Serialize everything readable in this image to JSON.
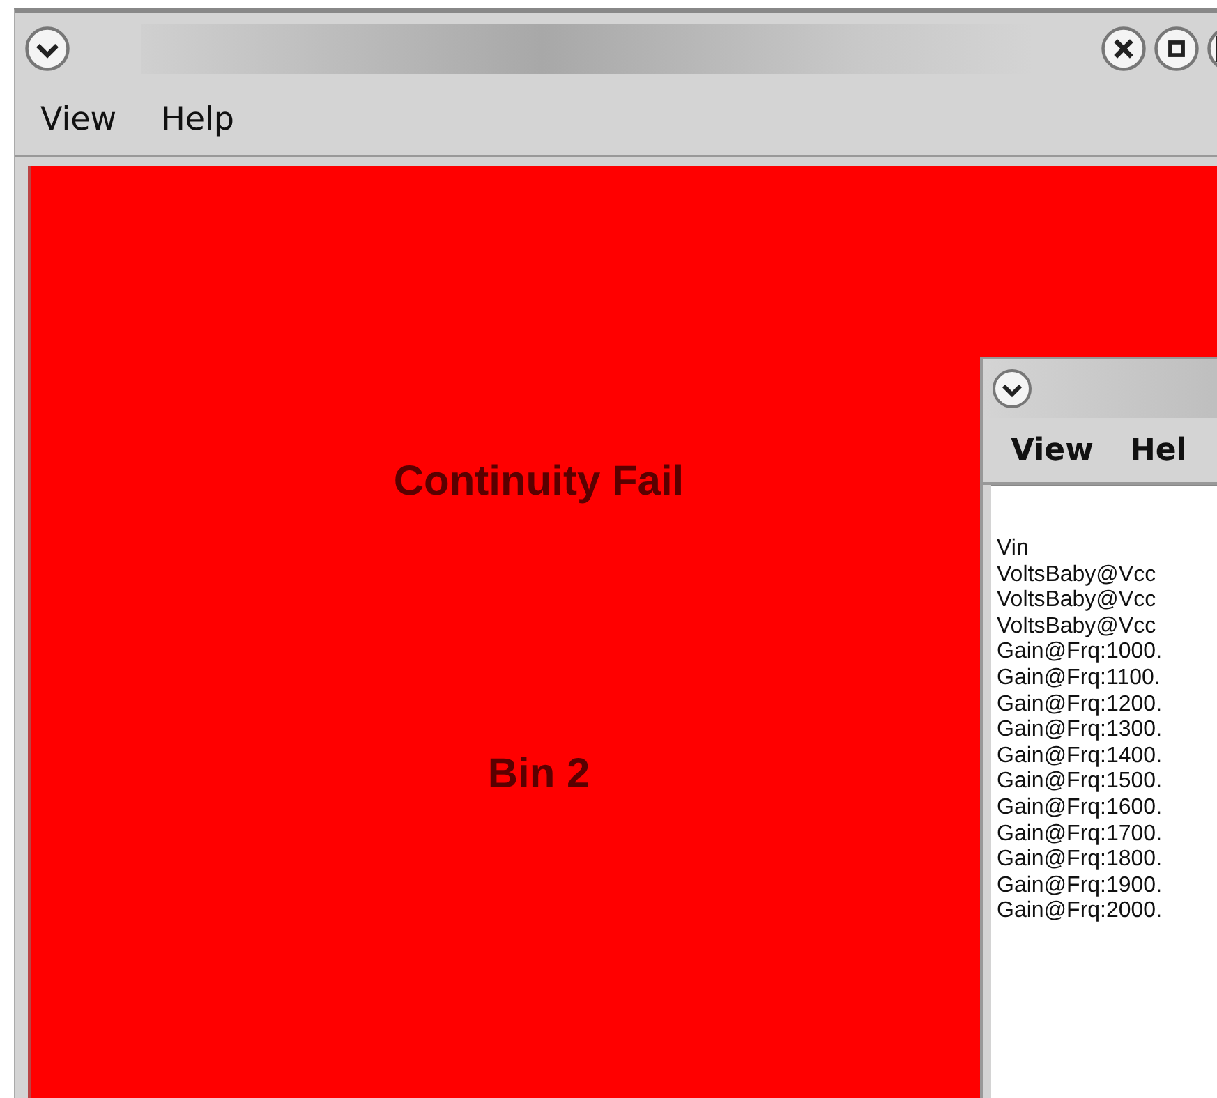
{
  "main_window": {
    "menu": [
      {
        "label": "View"
      },
      {
        "label": "Help"
      }
    ],
    "result": "Continuity Fail",
    "bin": "Bin 2"
  },
  "log_window": {
    "menu": [
      {
        "label": "View"
      },
      {
        "label": "Hel"
      }
    ],
    "lines": [
      "Vin",
      "VoltsBaby@Vcc",
      "VoltsBaby@Vcc",
      "VoltsBaby@Vcc",
      "Gain@Frq:1000.",
      "Gain@Frq:1100.",
      "Gain@Frq:1200.",
      "Gain@Frq:1300.",
      "Gain@Frq:1400.",
      "Gain@Frq:1500.",
      "Gain@Frq:1600.",
      "Gain@Frq:1700.",
      "Gain@Frq:1800.",
      "Gain@Frq:1900.",
      "Gain@Frq:2000."
    ]
  }
}
